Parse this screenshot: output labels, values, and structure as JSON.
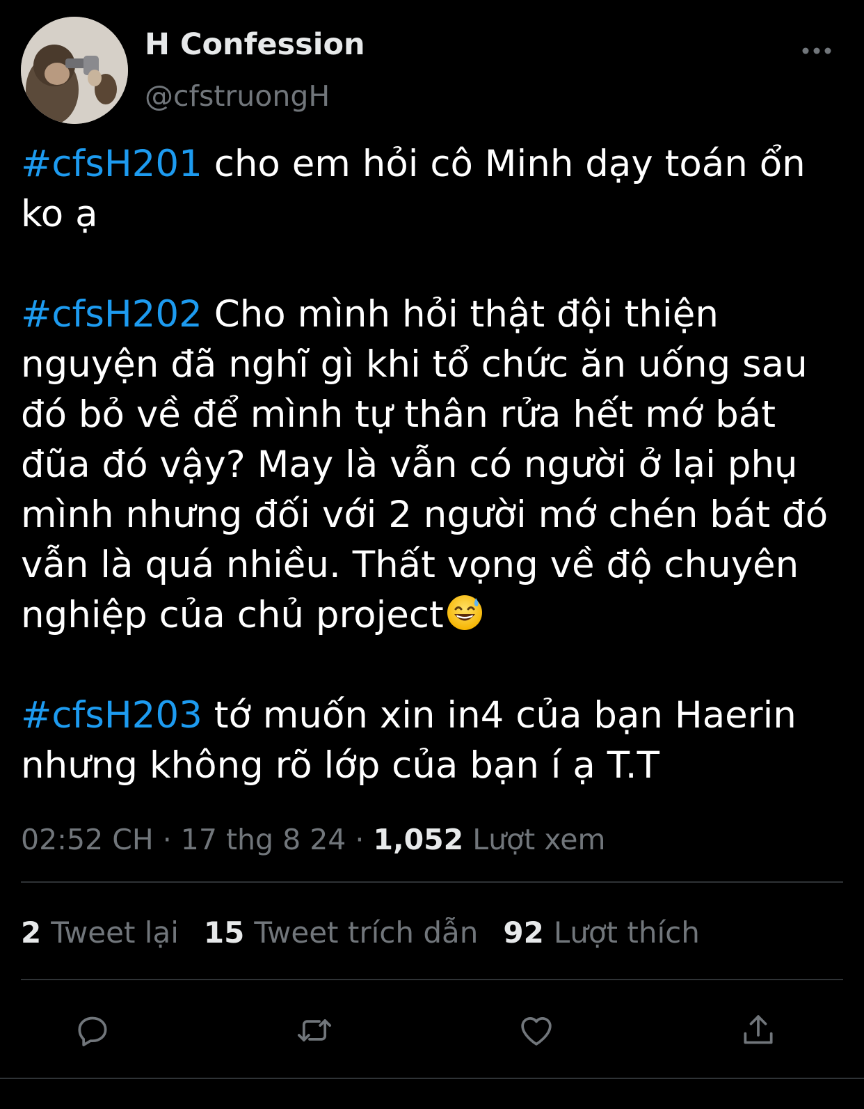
{
  "author": {
    "display_name": "H Confession",
    "handle": "@cfstruongH"
  },
  "tweet": {
    "paragraphs": [
      {
        "hashtag": "#cfsH201",
        "text": " cho em hỏi cô Minh dạy toán ổn ko ạ"
      },
      {
        "hashtag": "#cfsH202",
        "text": " Cho mình hỏi thật đội thiện nguyện đã nghĩ gì khi tổ chức ăn uống sau đó bỏ về để mình tự thân rửa hết mớ bát đũa đó vậy? May là vẫn có người ở lại phụ mình nhưng đối với 2 người mớ chén bát đó vẫn là quá nhiều. Thất vọng về độ chuyên nghiệp của chủ project"
      },
      {
        "hashtag": "#cfsH203",
        "text": " tớ muốn xin in4 của bạn Haerin nhưng không rõ lớp của bạn í ạ T.T"
      }
    ],
    "emoji": "grinning-sweat-emoji"
  },
  "meta": {
    "time": "02:52 CH",
    "separator": " · ",
    "date": "17 thg 8 24",
    "views_count": "1,052",
    "views_label": "Lượt xem"
  },
  "stats": {
    "retweets_count": "2",
    "retweets_label": "Tweet lại",
    "quotes_count": "15",
    "quotes_label": "Tweet trích dẫn",
    "likes_count": "92",
    "likes_label": "Lượt thích"
  },
  "actions": {
    "icons": [
      "reply-icon",
      "retweet-icon",
      "like-icon",
      "share-icon"
    ]
  },
  "colors": {
    "background": "#000000",
    "text": "#e7e9ea",
    "secondary": "#71767b",
    "accent": "#1d9bf0",
    "divider": "#2f3336"
  }
}
